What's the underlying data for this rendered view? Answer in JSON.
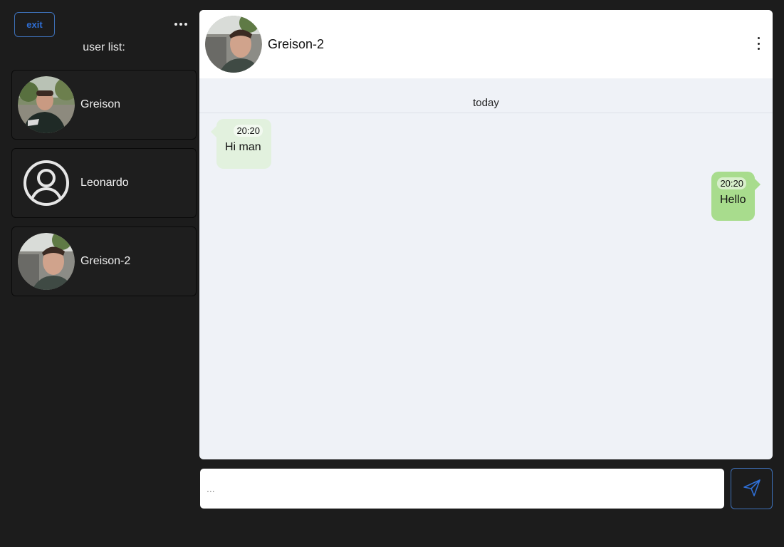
{
  "sidebar": {
    "exit_label": "exit",
    "title": "user list:",
    "users": [
      {
        "name": "Greison",
        "avatar": "photo"
      },
      {
        "name": "Leonardo",
        "avatar": "default-user-icon"
      },
      {
        "name": "Greison-2",
        "avatar": "photo"
      }
    ]
  },
  "chat": {
    "title": "Greison-2",
    "day_separator": "today",
    "messages": [
      {
        "direction": "incoming",
        "time": "20:20",
        "text": "Hi man"
      },
      {
        "direction": "outgoing",
        "time": "20:20",
        "text": "Hello"
      }
    ]
  },
  "composer": {
    "placeholder": "...",
    "value": ""
  },
  "colors": {
    "background": "#1c1c1c",
    "accent": "#2f6fd6",
    "chat_bg": "#eff2f7",
    "incoming_bubble": "#e2f1de",
    "outgoing_bubble": "#a8dc8d"
  },
  "icons": [
    "more-horizontal-icon",
    "more-vertical-icon",
    "send-icon",
    "user-circle-icon"
  ]
}
